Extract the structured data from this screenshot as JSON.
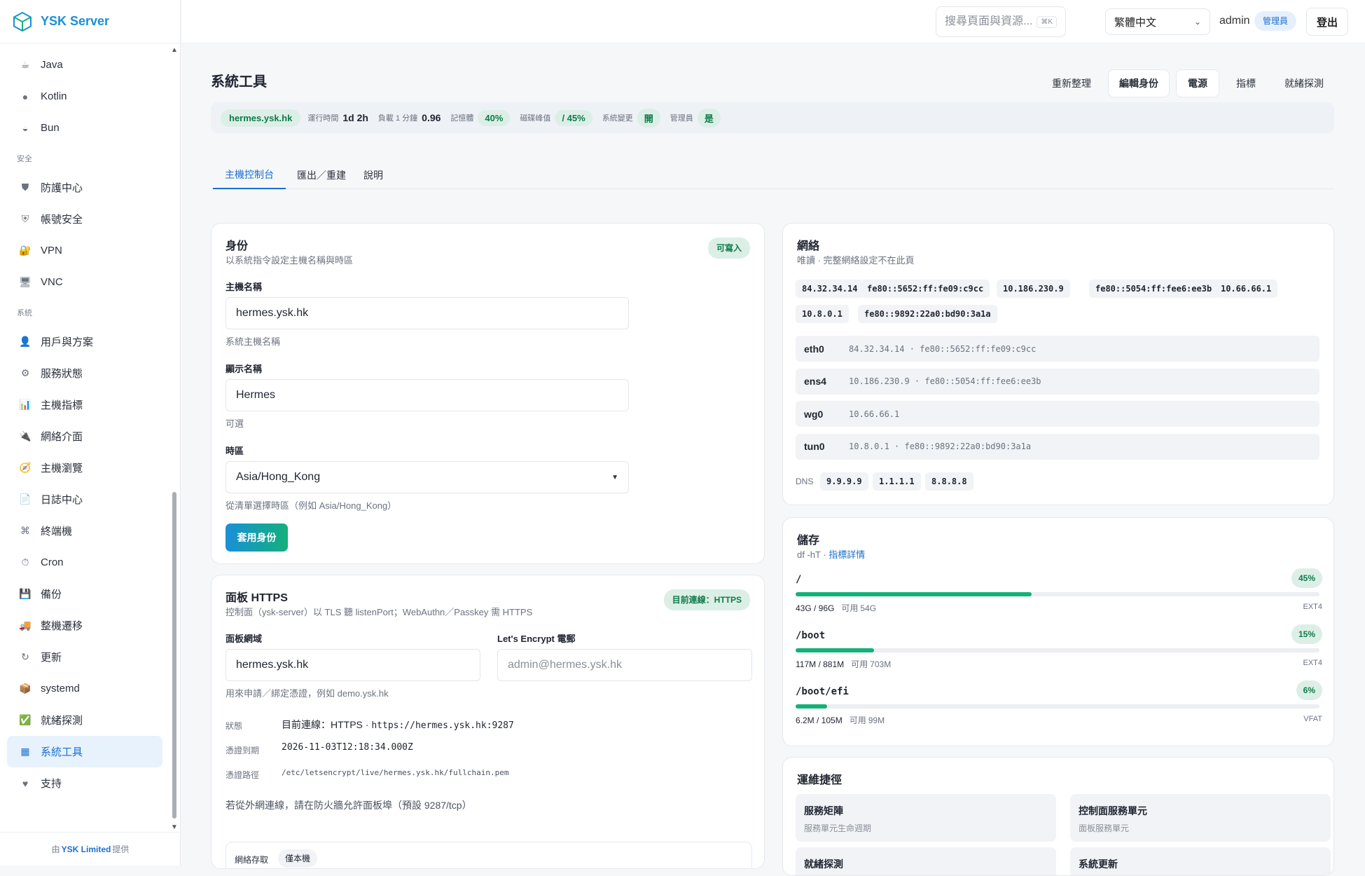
{
  "brand": {
    "name": "YSK Server"
  },
  "sidebar": {
    "items": [
      {
        "label": "Java",
        "icon": "coffee-icon",
        "glyph": "☕"
      },
      {
        "label": "Kotlin",
        "icon": "kotlin-icon",
        "glyph": "●"
      },
      {
        "label": "Bun",
        "icon": "bun-icon",
        "glyph": "◒"
      },
      {
        "group": "安全"
      },
      {
        "label": "防護中心",
        "icon": "shield-icon",
        "glyph": "⛊"
      },
      {
        "label": "帳號安全",
        "icon": "shield-check-icon",
        "glyph": "⛨"
      },
      {
        "label": "VPN",
        "icon": "lock-icon",
        "glyph": "🔐"
      },
      {
        "label": "VNC",
        "icon": "monitor-icon",
        "glyph": "🖥"
      },
      {
        "group": "系統"
      },
      {
        "label": "用戶與方案",
        "icon": "user-icon",
        "glyph": "👤"
      },
      {
        "label": "服務狀態",
        "icon": "gear-icon",
        "glyph": "⚙"
      },
      {
        "label": "主機指標",
        "icon": "chart-icon",
        "glyph": "📊"
      },
      {
        "label": "網絡介面",
        "icon": "plug-icon",
        "glyph": "🔌"
      },
      {
        "label": "主機瀏覽",
        "icon": "compass-icon",
        "glyph": "🧭"
      },
      {
        "label": "日誌中心",
        "icon": "document-icon",
        "glyph": "📄"
      },
      {
        "label": "終端機",
        "icon": "command-icon",
        "glyph": "⌘"
      },
      {
        "label": "Cron",
        "icon": "clock-icon",
        "glyph": "⏱"
      },
      {
        "label": "備份",
        "icon": "floppy-icon",
        "glyph": "💾"
      },
      {
        "label": "整機遷移",
        "icon": "truck-icon",
        "glyph": "🚚"
      },
      {
        "label": "更新",
        "icon": "refresh-icon",
        "glyph": "↻"
      },
      {
        "label": "systemd",
        "icon": "package-icon",
        "glyph": "📦"
      },
      {
        "label": "就緒探測",
        "icon": "checkbox-icon",
        "glyph": "✅"
      },
      {
        "label": "系統工具",
        "icon": "grid-icon",
        "glyph": "▦",
        "active": true
      },
      {
        "label": "支持",
        "icon": "heart-icon",
        "glyph": "♥"
      }
    ],
    "footer_prefix": "由",
    "footer_company": "YSK Limited",
    "footer_suffix": "提供"
  },
  "topbar": {
    "search_placeholder": "搜尋頁面與資源...",
    "search_shortcut": "⌘K",
    "language": "繁體中文",
    "username": "admin",
    "role": "管理員",
    "logout": "登出"
  },
  "page": {
    "title": "系統工具",
    "actions": {
      "refresh": "重新整理",
      "edit_identity": "編輯身份",
      "power": "電源",
      "metrics": "指標",
      "probe": "就緒探測"
    }
  },
  "status": {
    "host": "hermes.ysk.hk",
    "uptime_label": "運行時間",
    "uptime": "1d 2h",
    "load_label": "負載 1 分鐘",
    "load": "0.96",
    "memory_label": "記憶體",
    "memory": "40%",
    "disk_label": "磁碟峰值",
    "disk": "/ 45%",
    "changes_label": "系統變更",
    "changes": "開",
    "admin_label": "管理員",
    "admin": "是"
  },
  "tabs": [
    "主機控制台",
    "匯出／重建",
    "說明"
  ],
  "identity": {
    "title": "身份",
    "subtitle": "以系統指令設定主機名稱與時區",
    "badge": "可寫入",
    "hostname_label": "主機名稱",
    "hostname": "hermes.ysk.hk",
    "hostname_help": "系統主機名稱",
    "display_label": "顯示名稱",
    "display": "Hermes",
    "display_help": "可選",
    "tz_label": "時區",
    "tz": "Asia/Hong_Kong",
    "tz_help": "從清單選擇時區（例如 Asia/Hong_Kong）",
    "apply": "套用身份"
  },
  "https": {
    "title": "面板 HTTPS",
    "subtitle": "控制面（ysk-server）以 TLS 聽 listenPort；WebAuthn／Passkey 需 HTTPS",
    "badge": "目前連線：HTTPS",
    "domain_label": "面板網域",
    "domain": "hermes.ysk.hk",
    "domain_help": "用來申請／綁定憑證，例如 demo.ysk.hk",
    "email_label": "Let's Encrypt 電郵",
    "email_placeholder": "admin@hermes.ysk.hk",
    "state_label": "狀態",
    "state_prefix": "目前連線：HTTPS · ",
    "state_url": "https://hermes.ysk.hk:9287",
    "expiry_label": "憑證到期",
    "expiry": "2026-11-03T12:18:34.000Z",
    "path_label": "憑證路徑",
    "path": "/etc/letsencrypt/live/hermes.ysk.hk/fullchain.pem",
    "firewall_note": "若從外網連線，請在防火牆允許面板埠（預設 9287/tcp）",
    "access_label": "網絡存取",
    "access_value": "僅本機"
  },
  "network": {
    "title": "網絡",
    "subtitle": "唯讀 · 完整網絡設定不在此頁",
    "addresses": [
      "84.32.34.14",
      "fe80::5652:ff:fe09:c9cc",
      "10.186.230.9",
      "fe80::5054:ff:fee6:ee3b",
      "10.66.66.1",
      "10.8.0.1",
      "fe80::9892:22a0:bd90:3a1a"
    ],
    "interfaces": [
      {
        "name": "eth0",
        "addr": "84.32.34.14 · fe80::5652:ff:fe09:c9cc"
      },
      {
        "name": "ens4",
        "addr": "10.186.230.9 · fe80::5054:ff:fee6:ee3b"
      },
      {
        "name": "wg0",
        "addr": "10.66.66.1"
      },
      {
        "name": "tun0",
        "addr": "10.8.0.1 · fe80::9892:22a0:bd90:3a1a"
      }
    ],
    "dns_label": "DNS",
    "dns": [
      "9.9.9.9",
      "1.1.1.1",
      "8.8.8.8"
    ]
  },
  "storage": {
    "title": "儲存",
    "subtitle_prefix": "df -hT · ",
    "subtitle_link": "指標詳情",
    "avail_prefix": "可用",
    "disks": [
      {
        "mount": "/",
        "pct": "45%",
        "fraction": 0.45,
        "used": "43G / 96G",
        "avail": "54G",
        "fstype": "EXT4"
      },
      {
        "mount": "/boot",
        "pct": "15%",
        "fraction": 0.15,
        "used": "117M / 881M",
        "avail": "703M",
        "fstype": "EXT4"
      },
      {
        "mount": "/boot/efi",
        "pct": "6%",
        "fraction": 0.06,
        "used": "6.2M / 105M",
        "avail": "99M",
        "fstype": "VFAT"
      }
    ]
  },
  "ops": {
    "title": "運維捷徑",
    "shortcuts": [
      {
        "title": "服務矩陣",
        "desc": "服務單元生命週期"
      },
      {
        "title": "控制面服務單元",
        "desc": "面板服務單元"
      },
      {
        "title": "就緒探測",
        "desc": ""
      },
      {
        "title": "系統更新",
        "desc": ""
      }
    ]
  }
}
